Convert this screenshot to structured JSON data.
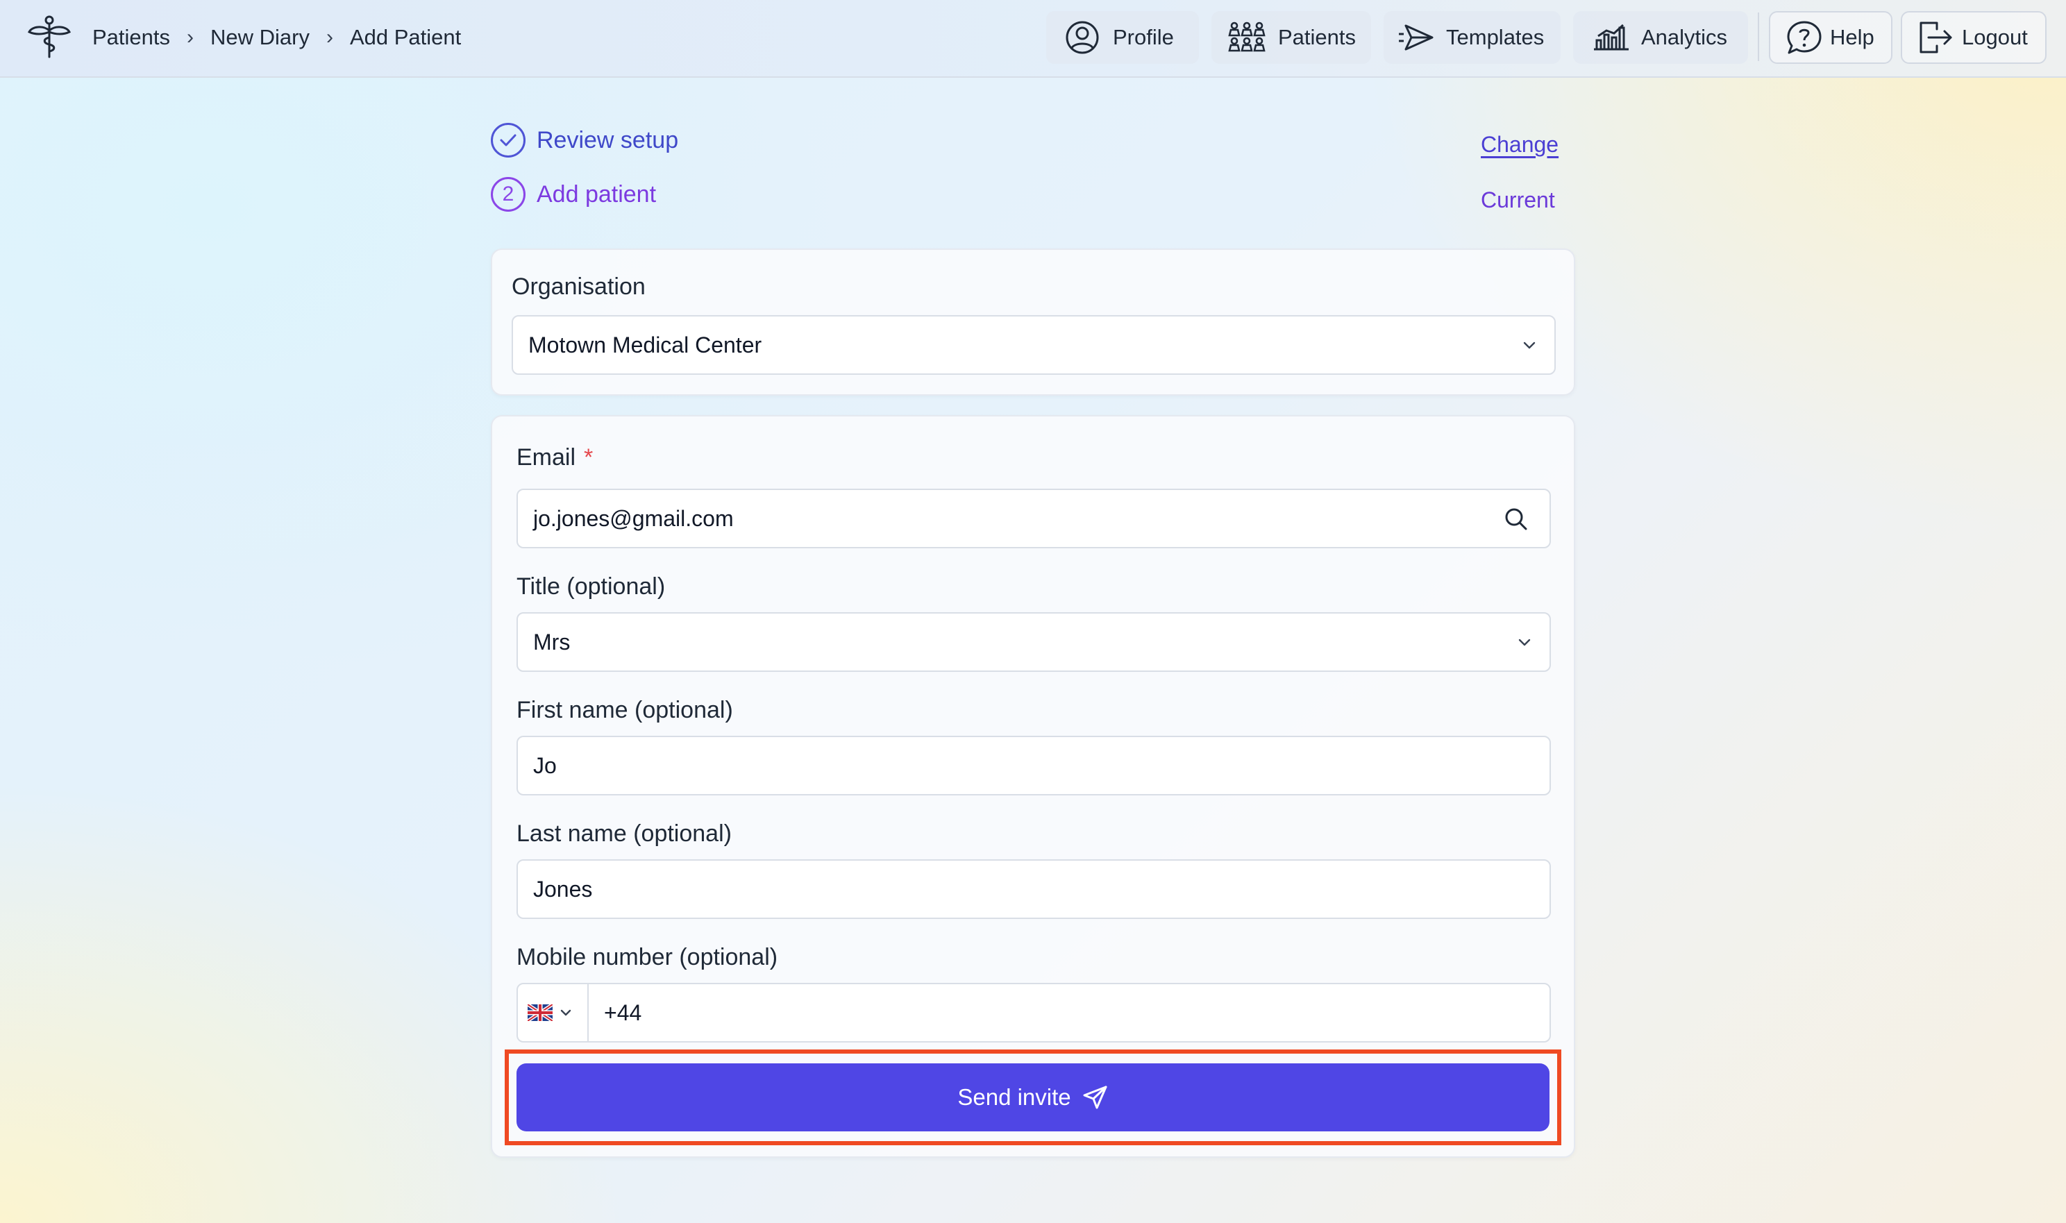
{
  "breadcrumb": [
    "Patients",
    "New Diary",
    "Add Patient"
  ],
  "breadcrumb_separator": "›",
  "nav": {
    "profile": "Profile",
    "patients": "Patients",
    "templates": "Templates",
    "analytics": "Analytics",
    "help": "Help",
    "logout": "Logout"
  },
  "steps": [
    {
      "label": "Review setup",
      "status_link": "Change",
      "icon": "check-circle-icon"
    },
    {
      "label": "Add patient",
      "number": "2",
      "status_link": "Current"
    }
  ],
  "organisation": {
    "label": "Organisation",
    "value": "Motown Medical Center"
  },
  "form": {
    "email": {
      "label": "Email",
      "required_mark": "*",
      "value": "jo.jones@gmail.com"
    },
    "title": {
      "label": "Title (optional)",
      "value": "Mrs"
    },
    "first_name": {
      "label": "First name (optional)",
      "value": "Jo"
    },
    "last_name": {
      "label": "Last name (optional)",
      "value": "Jones"
    },
    "mobile": {
      "label": "Mobile number (optional)",
      "country_flag": "uk-flag-icon",
      "value": "+44"
    },
    "submit_label": "Send invite"
  },
  "colors": {
    "primary": "#4f46e5",
    "highlight_outline": "#ef4a23",
    "step_complete": "#3f48c9",
    "step_current": "#7c3ae0",
    "required": "#e5484d"
  }
}
